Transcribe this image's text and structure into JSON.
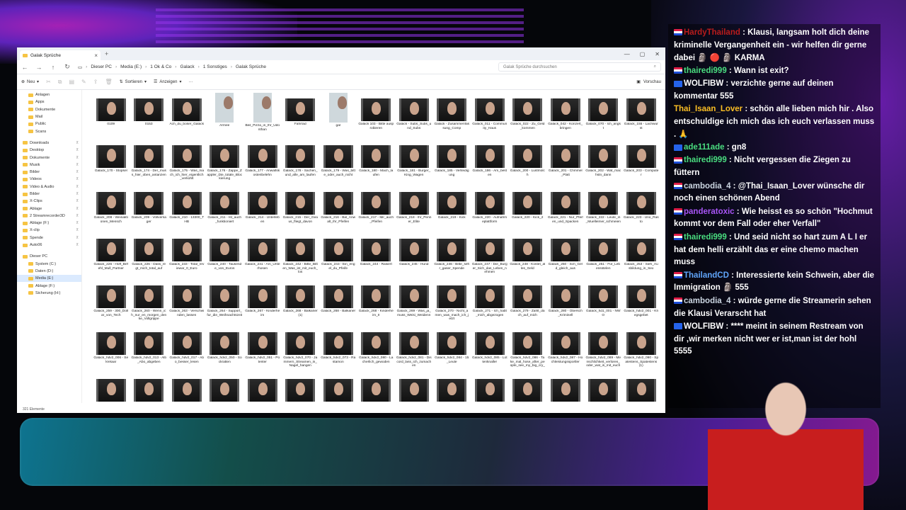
{
  "window": {
    "tab_title": "Galak Sprüche",
    "breadcrumbs": [
      "Dieser PC",
      "Media (E:)",
      "1 Ok & Co",
      "Galack",
      "1 Sonstiges",
      "Galak Sprüche"
    ],
    "search_placeholder": "Galak Sprüche durchsuchen",
    "toolbar": {
      "new": "Neu",
      "sort": "Sortieren",
      "view": "Anzeigen",
      "more": "···",
      "preview": "Vorschau"
    },
    "status": "321 Elemente"
  },
  "sidebar": {
    "quick": [
      "Anlagen",
      "Apps",
      "Dokumente",
      "Mail",
      "Public",
      "Scans"
    ],
    "pinned": [
      "Downloads",
      "Desktop",
      "Dokumente",
      "Musik",
      "Bilder",
      "Videos",
      "Video & Audio",
      "Bilder",
      "X-Clips",
      "Ablage",
      "2 Streamrecorder3D",
      "Ablage (F:)",
      "X-clip",
      "Spende",
      "Auto06"
    ],
    "drives": [
      "Dieser PC",
      "System (C:)",
      "Daten (D:)",
      "Media (E:)",
      "Ablage (F:)",
      "Sicherung (H:)"
    ]
  },
  "files": [
    "0109",
    "0153",
    "Ach_du_boser_Galack",
    "Armee",
    "Beil_Pizza_in_Ihr_Udonthan",
    "Fahrrad",
    "gal",
    "Galack 103 - Bitte ausprobieren",
    "Galack - Subs_Subs_und_Subs",
    "Galack - Zusammenfassung_Comp",
    "Galack_011 - Community_Haus",
    "Galack_022 - Zu_Geld_kommen",
    "Galack_042 - Konzert_bringen",
    "Galack_070 - Ich_angst",
    "Galack_155 - Lachwurst",
    "Galack_170 - Stopsel",
    "Galack_174 - Der_muss_hier_oben_antanzen",
    "Galack_175 - Was_mach_ich_hier_eigentlich_verkohlt",
    "Galack_176 - Zappe_Zappler_Die_totale_Blockierung",
    "Galack_177 - Anwaltskostenbelehn",
    "Galack_178 - Sachen_und_alle_am_laufen",
    "Galack_179 - Was_bitte_oder_auch_nicht",
    "Galack_180 - Mach_laufen",
    "Galack_181 - Burger_King_Wagen",
    "Galack_185 - Verteidigung",
    "Galack_186 - Am_besten",
    "Galack_200 - Lustmolch",
    "Galack_201 - Chmmel_Platt",
    "Galack_202 - Wat_machstn_dann",
    "Galack_203 - Computer",
    "Galack_208 - Weinaktionen_Mensch",
    "Galack_209 - Vollversager",
    "Galack_210 - 13300_THB",
    "Galack_211 - Ist_auch_funktioniert",
    "Galack_214 - Unterleben",
    "Galack_215 - Der_Geaus_fliegt_davon",
    "Galack_216 - Bal_Anwalt_Ihr_Pfeifen",
    "Galack_217 - Mir_auch_Pfeifen",
    "Galack_218 - Ihr_Penner_Elite",
    "Galack_219 - Kick",
    "Galack_220 - Aufnahmeplattform",
    "Galack_220 - Kick_2",
    "Galack_221 - Nur_Pfeifen_und_Spacken",
    "Galack_222 - Leute_in_Muelleimer_schmeien",
    "Galack_223 - Uno_Rasto",
    "Galack_226 - Hoff_Befehl_Mull_Partner",
    "Galack_226 - Dass_regt_mich_total_auf",
    "Galack_233 - Total_reviewar_0_Euro",
    "Galack_240 - Tausende_von_Euros",
    "Galack_241 - Am_Unterhosen",
    "Galack_242 - Bitte_Bitten_Was_ist_mit_euch_los",
    "Galack_243 - Ein_engel_du_Pfeife",
    "Galack_244 - Rasiert",
    "Galack_245 - Hund",
    "Galack_246 - Bitte_sehr_gaser_Spende",
    "Galack_247 - Die_Burger_Sich_das_Leben_nehmen",
    "Galack_248 - Kostet_alles_Geld",
    "Galack_250 - Sch_Geld_gleich_aus",
    "Galack_251 - Für_Lebensstelen",
    "Galack_253 - Sieh_Ausbildung_in_Sex",
    "Galack_259 - 300_Dollar_von_Tech",
    "Galack_260 - Wenn_ich_nur_en_morgen_denke_Vollgrippe",
    "Galack_263 - Verschwinden_lassen",
    "Galack_264 - Support_fur_die_Weihnachtszeit",
    "Galack_267 - Kinderheim",
    "Galack_268 - Balkaner (1)",
    "Galack_268 - Balkaner",
    "Galack_268 - Kinderheim_II",
    "Galack_269 - Was_ja_muss_Weisi_Weidenn",
    "Galack_270 - Nicht_amen_was_mach_ich_jetzt",
    "Galack_271 - Ich_habt_mich_abgezogen",
    "Galack_279 - Zahlt_dach_auf_mich",
    "Galack_280 - Obersch_Kriminell",
    "Galack_hd1_001 - NWO",
    "Galack_hdv2_001 - Kriegsgebet",
    "Galack_hdv2_006 - Sekretaar",
    "Galack_hdv2_013 - Alb_Abo_abgeben",
    "Galack_hdv2_017 - Abo_besser_lesen",
    "Galack_hdv2_050 - Sockratten",
    "Galack_hdv2_051 - Potenter",
    "Galack_hdv2_070 - Jammern_Streamen_in_Nagel_hangen",
    "Galack_hdv2_073 - Rastamon",
    "Galack_hdv2_080 - Lacherlich_gewoden",
    "Galack_hdv2_081 - Discord_lass_ich_zumachen",
    "Galack_hdv2_084 - 15_Leute",
    "Galack_hdv2_085 - Lottenknaller",
    "Galack_hdv2_086 - Take_mal_hose_after_people_see_my_big_cry_ey",
    "Galack_hdv2_087 - Hochleistungssportler",
    "Galack_hdv2_089 - Menschlichkeit_verloren_oder_wat_is_mit_euch",
    "Galack_hdv2_090 - Spatestens_Spatestens (1)"
  ],
  "chat": [
    {
      "name": "HardyThailand",
      "name_color": "#b91c1c",
      "badge": "flag",
      "text": "Klausi, langsam holt dich deine kriminelle Vergangenheit ein - wir helfen dir gerne dabei 🗿 🔴 🗿 KARMA"
    },
    {
      "name": "thairedi999",
      "name_color": "#4ade80",
      "badge": "flag",
      "text": "Wann ist exit?"
    },
    {
      "name": "WOLFIBW",
      "name_color": "#ffffff",
      "badge": "tw",
      "text": "verzichte gerne auf deinen kommentar 555"
    },
    {
      "name": "Thai_Isaan_Lover",
      "name_color": "#fbbf24",
      "badge": "none",
      "text": "schön alle lieben mich hir . Also entschuldige ich mich das ich euch verlassen muss . 🙏"
    },
    {
      "name": "ade111ade",
      "name_color": "#4ade80",
      "badge": "tw",
      "text": "gn8"
    },
    {
      "name": "thairedi999",
      "name_color": "#4ade80",
      "badge": "flag",
      "text": "Nicht vergessen die Ziegen zu füttern"
    },
    {
      "name": "cambodia_4",
      "name_color": "#cbd5e1",
      "badge": "flag",
      "text": "@Thai_Isaan_Lover wünsche dir noch einen schönen Abend"
    },
    {
      "name": "panderatoxic",
      "name_color": "#a855f7",
      "badge": "flag",
      "text": "Wie heisst es so schön \"Hochmut kommt vor dem Fall oder eher Verfall\""
    },
    {
      "name": "thairedi999",
      "name_color": "#4ade80",
      "badge": "flag",
      "text": "Und seid nicht so hart zum A L I er hat dem helli erzählt das er eine chemo machen muss"
    },
    {
      "name": "ThailandCD",
      "name_color": "#60a5fa",
      "badge": "flag",
      "text": "Interessierte kein Schwein, aber die Immigration 🗿 555"
    },
    {
      "name": "cambodia_4",
      "name_color": "#cbd5e1",
      "badge": "flag",
      "text": "würde gerne die Streamerin sehen die Klausi Verarscht hat"
    },
    {
      "name": "WOLFIBW",
      "name_color": "#ffffff",
      "badge": "tw",
      "text": "**** meint in seinem Restream von dir ,wir merken nicht wer er ist,man ist der hohl 5555"
    }
  ]
}
